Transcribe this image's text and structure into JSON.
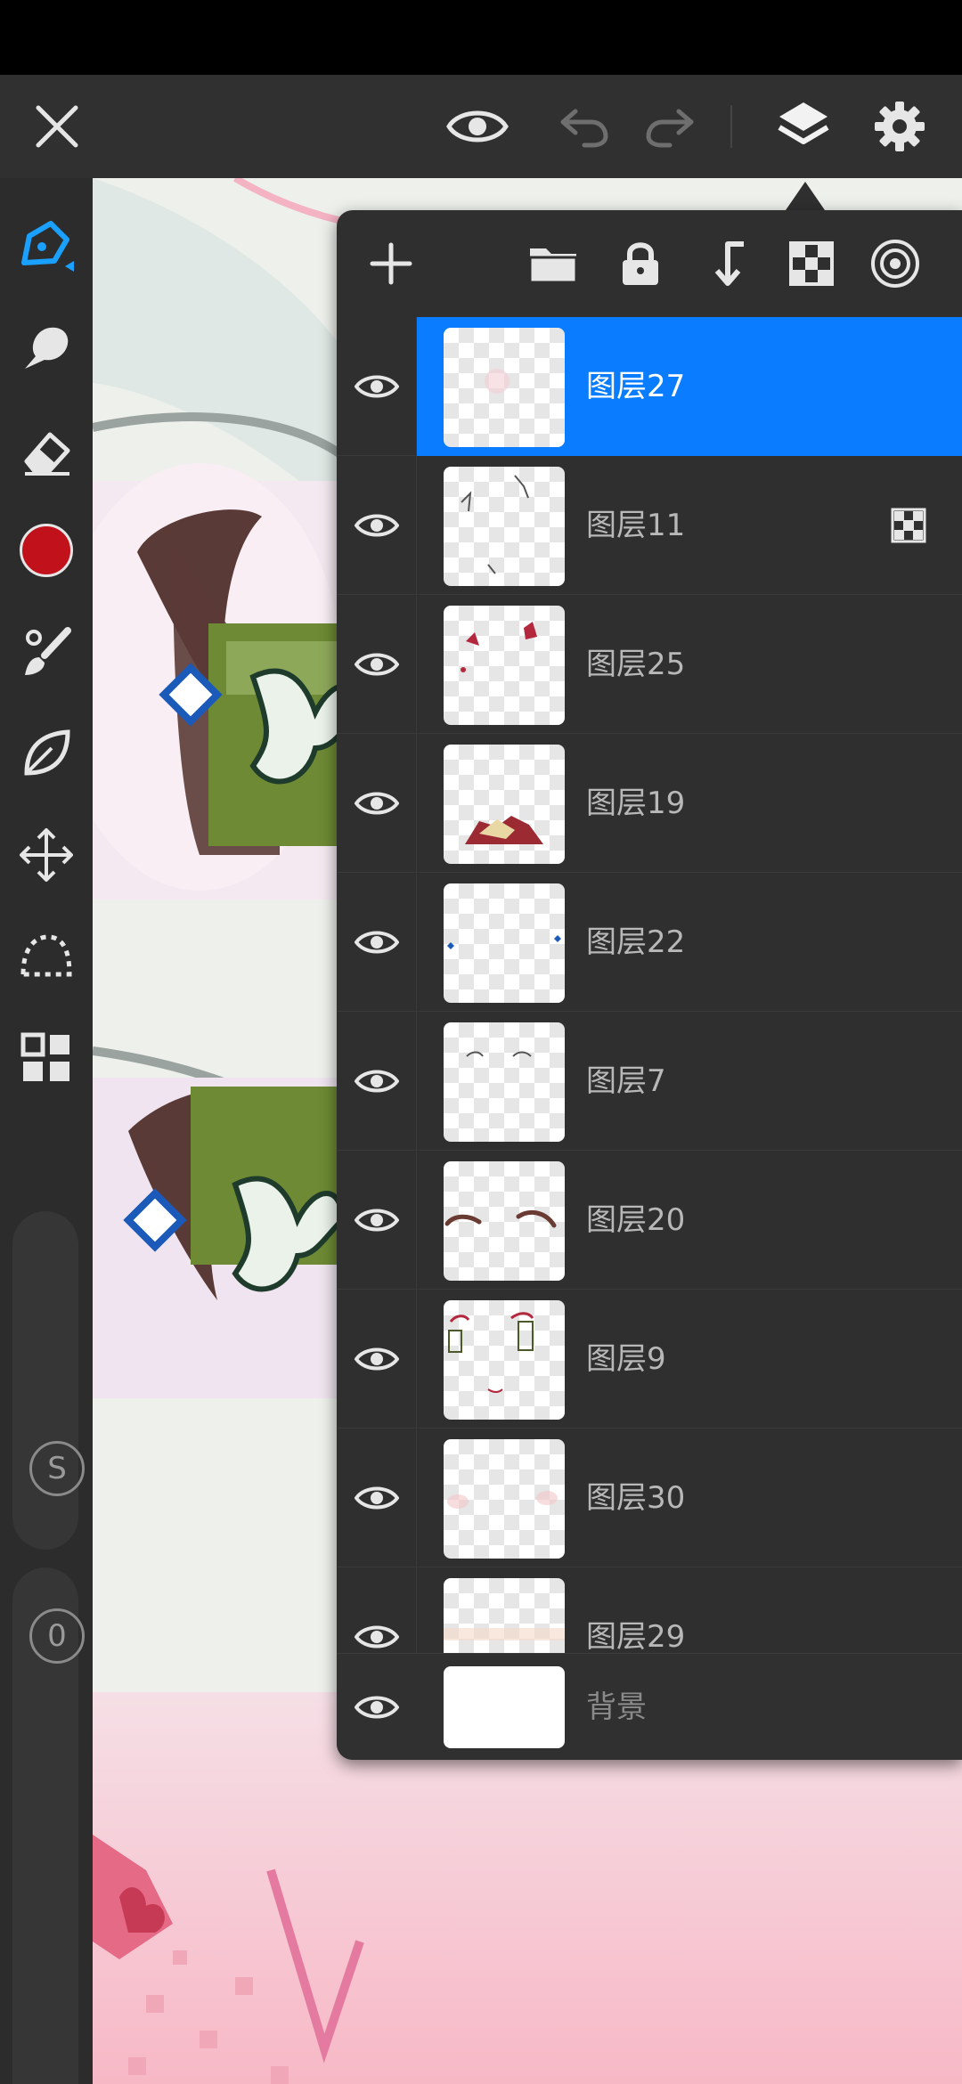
{
  "toolbar": {
    "close_icon": "close-icon",
    "preview_icon": "eye-icon",
    "undo_icon": "undo-icon",
    "redo_icon": "redo-icon",
    "layers_icon": "layers-icon",
    "settings_icon": "gear-icon"
  },
  "sidebar": {
    "tools": [
      "pen-tool",
      "smudge-tool",
      "eraser-tool",
      "color-picker",
      "brush-tool",
      "lasso-fill-tool",
      "transform-tool",
      "selection-tool",
      "gallery-tool"
    ],
    "active_color": "#c1121c",
    "size_label": "S",
    "opacity_label": "0"
  },
  "layers_panel": {
    "actions": [
      "add-layer",
      "new-folder",
      "lock-layer",
      "merge-down",
      "alpha-lock",
      "layer-blend"
    ],
    "layers": [
      {
        "name": "图层27",
        "selected": true
      },
      {
        "name": "图层11",
        "selected": false,
        "alpha_locked": true
      },
      {
        "name": "图层25",
        "selected": false
      },
      {
        "name": "图层19",
        "selected": false
      },
      {
        "name": "图层22",
        "selected": false
      },
      {
        "name": "图层7",
        "selected": false
      },
      {
        "name": "图层20",
        "selected": false
      },
      {
        "name": "图层9",
        "selected": false
      },
      {
        "name": "图层30",
        "selected": false
      },
      {
        "name": "图层29",
        "selected": false
      }
    ],
    "background_layer": {
      "name": "背景"
    }
  },
  "colors": {
    "accent": "#0a7cff",
    "panel": "#2f2f2f",
    "toolbar": "#303030"
  }
}
